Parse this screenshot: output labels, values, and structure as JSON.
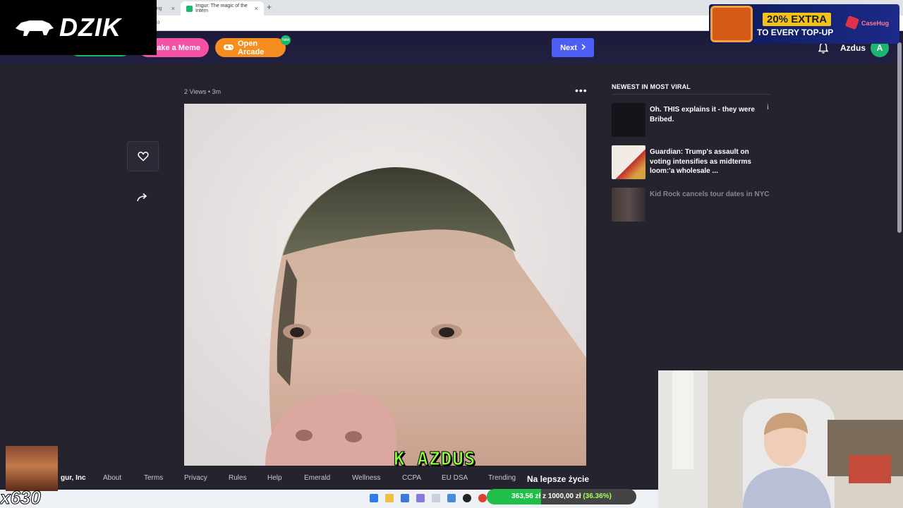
{
  "browser": {
    "tabs": [
      {
        "title": "ong",
        "active": false
      },
      {
        "title": "Imgur: The magic of the Intern",
        "active": true
      }
    ],
    "new_tab_icon": "plus-icon",
    "url_fragment": "o"
  },
  "overlay": {
    "dzik_brand": "DZIK",
    "promo_line1": "20% EXTRA",
    "promo_line2": "TO EVERY TOP-UP",
    "promo_brand": "CaseHug",
    "stream_name": "K AZDUS",
    "caption": "Na lepsze życie",
    "goal_current": "363,56 zł",
    "goal_separator": "z",
    "goal_total": "1000,00 zł",
    "goal_percent": "(36.36%)",
    "goal_progress": 0.3636,
    "multiplier": "x630"
  },
  "header": {
    "make_meme": "Make a Meme",
    "open_arcade": "Open Arcade",
    "arcade_badge": "new",
    "next": "Next",
    "username": "Azdus",
    "avatar_letter": "A",
    "colors": {
      "meme": "#f552a5",
      "arcade": "#f58d1f",
      "next": "#4d5ef5",
      "avatar": "#1bb76e"
    }
  },
  "post": {
    "views": "2 Views",
    "age": "3m",
    "menu_icon": "more-dots-icon",
    "like_icon": "heart-icon",
    "share_icon": "share-arrow-icon"
  },
  "sidebar": {
    "title": "NEWEST IN MOST VIRAL",
    "items": [
      {
        "title": "Oh. THIS explains it - they were Bribed."
      },
      {
        "title": "Guardian:  Trump's assault on voting intensifies as midterms loom:'a wholesale ..."
      },
      {
        "title": "Kid Rock cancels tour dates in NYC"
      }
    ]
  },
  "footer": {
    "links": [
      "gur, Inc",
      "About",
      "Terms",
      "Privacy",
      "Rules",
      "Help",
      "Emerald",
      "Wellness",
      "CCPA",
      "EU DSA",
      "Trending"
    ]
  }
}
